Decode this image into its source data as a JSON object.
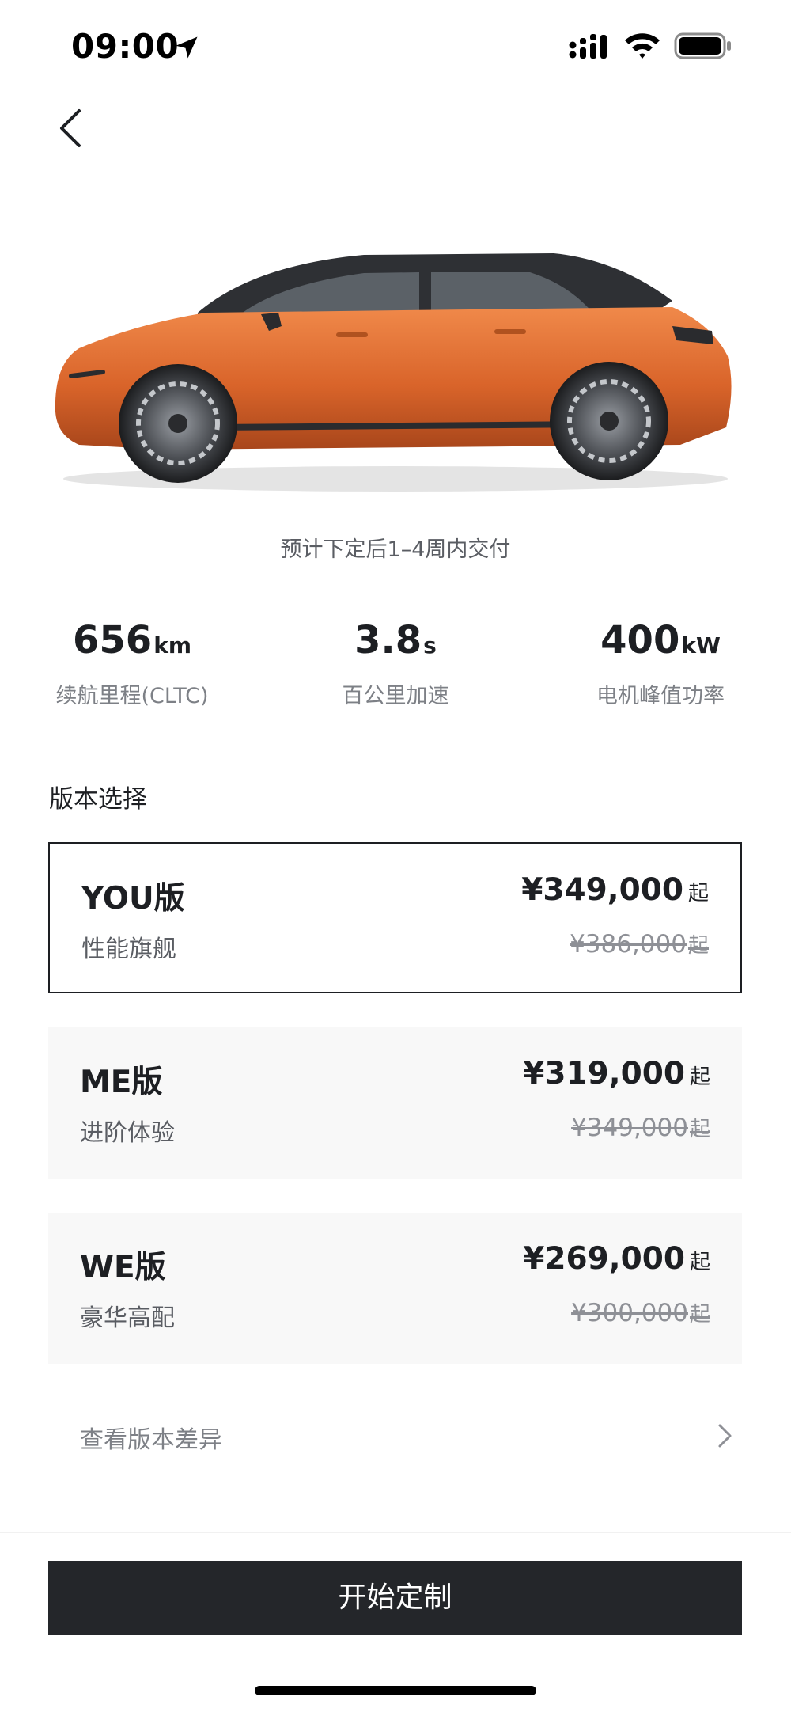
{
  "status_bar": {
    "time": "09:00",
    "icons": [
      "location-arrow-icon",
      "cellular-signal-icon",
      "wifi-icon",
      "battery-icon"
    ]
  },
  "nav": {
    "back_icon": "chevron-left-icon"
  },
  "car": {
    "image_icon": "car-side-view-orange",
    "body_color": "#d9642a"
  },
  "delivery_note": "预计下定后1–4周内交付",
  "specs": [
    {
      "value": "656",
      "unit": "km",
      "label": "续航里程(CLTC)"
    },
    {
      "value": "3.8",
      "unit": "s",
      "label": "百公里加速"
    },
    {
      "value": "400",
      "unit": "kW",
      "label": "电机峰值功率"
    }
  ],
  "version_section": {
    "title": "版本选择",
    "versions": [
      {
        "name": "YOU版",
        "desc": "性能旗舰",
        "price": "¥349,000",
        "price_suffix": "起",
        "original_price": "¥386,000",
        "original_suffix": "起",
        "selected": true
      },
      {
        "name": "ME版",
        "desc": "进阶体验",
        "price": "¥319,000",
        "price_suffix": "起",
        "original_price": "¥349,000",
        "original_suffix": "起",
        "selected": false
      },
      {
        "name": "WE版",
        "desc": "豪华高配",
        "price": "¥269,000",
        "price_suffix": "起",
        "original_price": "¥300,000",
        "original_suffix": "起",
        "selected": false
      }
    ],
    "compare_label": "查看版本差异"
  },
  "cta": {
    "label": "开始定制"
  },
  "colors": {
    "primary_dark": "#24262a",
    "card_bg": "#f8f8f8",
    "accent_orange": "#d9642a"
  }
}
